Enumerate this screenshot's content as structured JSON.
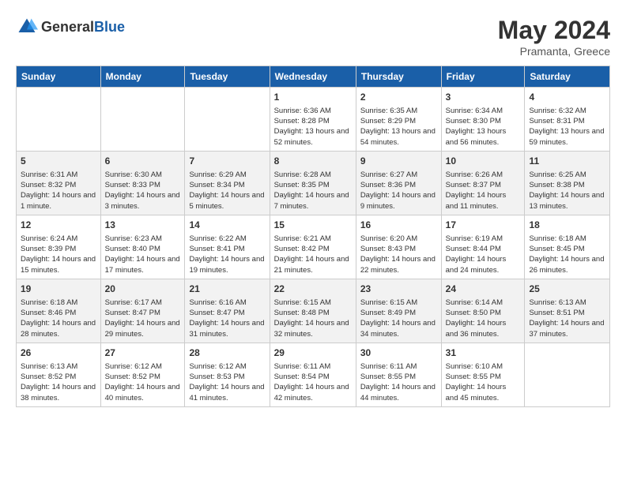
{
  "header": {
    "logo": {
      "general": "General",
      "blue": "Blue"
    },
    "title": "May 2024",
    "subtitle": "Pramanta, Greece"
  },
  "weekdays": [
    "Sunday",
    "Monday",
    "Tuesday",
    "Wednesday",
    "Thursday",
    "Friday",
    "Saturday"
  ],
  "weeks": [
    [
      null,
      null,
      null,
      {
        "day": "1",
        "sunrise": "Sunrise: 6:36 AM",
        "sunset": "Sunset: 8:28 PM",
        "daylight": "Daylight: 13 hours and 52 minutes."
      },
      {
        "day": "2",
        "sunrise": "Sunrise: 6:35 AM",
        "sunset": "Sunset: 8:29 PM",
        "daylight": "Daylight: 13 hours and 54 minutes."
      },
      {
        "day": "3",
        "sunrise": "Sunrise: 6:34 AM",
        "sunset": "Sunset: 8:30 PM",
        "daylight": "Daylight: 13 hours and 56 minutes."
      },
      {
        "day": "4",
        "sunrise": "Sunrise: 6:32 AM",
        "sunset": "Sunset: 8:31 PM",
        "daylight": "Daylight: 13 hours and 59 minutes."
      }
    ],
    [
      {
        "day": "5",
        "sunrise": "Sunrise: 6:31 AM",
        "sunset": "Sunset: 8:32 PM",
        "daylight": "Daylight: 14 hours and 1 minute."
      },
      {
        "day": "6",
        "sunrise": "Sunrise: 6:30 AM",
        "sunset": "Sunset: 8:33 PM",
        "daylight": "Daylight: 14 hours and 3 minutes."
      },
      {
        "day": "7",
        "sunrise": "Sunrise: 6:29 AM",
        "sunset": "Sunset: 8:34 PM",
        "daylight": "Daylight: 14 hours and 5 minutes."
      },
      {
        "day": "8",
        "sunrise": "Sunrise: 6:28 AM",
        "sunset": "Sunset: 8:35 PM",
        "daylight": "Daylight: 14 hours and 7 minutes."
      },
      {
        "day": "9",
        "sunrise": "Sunrise: 6:27 AM",
        "sunset": "Sunset: 8:36 PM",
        "daylight": "Daylight: 14 hours and 9 minutes."
      },
      {
        "day": "10",
        "sunrise": "Sunrise: 6:26 AM",
        "sunset": "Sunset: 8:37 PM",
        "daylight": "Daylight: 14 hours and 11 minutes."
      },
      {
        "day": "11",
        "sunrise": "Sunrise: 6:25 AM",
        "sunset": "Sunset: 8:38 PM",
        "daylight": "Daylight: 14 hours and 13 minutes."
      }
    ],
    [
      {
        "day": "12",
        "sunrise": "Sunrise: 6:24 AM",
        "sunset": "Sunset: 8:39 PM",
        "daylight": "Daylight: 14 hours and 15 minutes."
      },
      {
        "day": "13",
        "sunrise": "Sunrise: 6:23 AM",
        "sunset": "Sunset: 8:40 PM",
        "daylight": "Daylight: 14 hours and 17 minutes."
      },
      {
        "day": "14",
        "sunrise": "Sunrise: 6:22 AM",
        "sunset": "Sunset: 8:41 PM",
        "daylight": "Daylight: 14 hours and 19 minutes."
      },
      {
        "day": "15",
        "sunrise": "Sunrise: 6:21 AM",
        "sunset": "Sunset: 8:42 PM",
        "daylight": "Daylight: 14 hours and 21 minutes."
      },
      {
        "day": "16",
        "sunrise": "Sunrise: 6:20 AM",
        "sunset": "Sunset: 8:43 PM",
        "daylight": "Daylight: 14 hours and 22 minutes."
      },
      {
        "day": "17",
        "sunrise": "Sunrise: 6:19 AM",
        "sunset": "Sunset: 8:44 PM",
        "daylight": "Daylight: 14 hours and 24 minutes."
      },
      {
        "day": "18",
        "sunrise": "Sunrise: 6:18 AM",
        "sunset": "Sunset: 8:45 PM",
        "daylight": "Daylight: 14 hours and 26 minutes."
      }
    ],
    [
      {
        "day": "19",
        "sunrise": "Sunrise: 6:18 AM",
        "sunset": "Sunset: 8:46 PM",
        "daylight": "Daylight: 14 hours and 28 minutes."
      },
      {
        "day": "20",
        "sunrise": "Sunrise: 6:17 AM",
        "sunset": "Sunset: 8:47 PM",
        "daylight": "Daylight: 14 hours and 29 minutes."
      },
      {
        "day": "21",
        "sunrise": "Sunrise: 6:16 AM",
        "sunset": "Sunset: 8:47 PM",
        "daylight": "Daylight: 14 hours and 31 minutes."
      },
      {
        "day": "22",
        "sunrise": "Sunrise: 6:15 AM",
        "sunset": "Sunset: 8:48 PM",
        "daylight": "Daylight: 14 hours and 32 minutes."
      },
      {
        "day": "23",
        "sunrise": "Sunrise: 6:15 AM",
        "sunset": "Sunset: 8:49 PM",
        "daylight": "Daylight: 14 hours and 34 minutes."
      },
      {
        "day": "24",
        "sunrise": "Sunrise: 6:14 AM",
        "sunset": "Sunset: 8:50 PM",
        "daylight": "Daylight: 14 hours and 36 minutes."
      },
      {
        "day": "25",
        "sunrise": "Sunrise: 6:13 AM",
        "sunset": "Sunset: 8:51 PM",
        "daylight": "Daylight: 14 hours and 37 minutes."
      }
    ],
    [
      {
        "day": "26",
        "sunrise": "Sunrise: 6:13 AM",
        "sunset": "Sunset: 8:52 PM",
        "daylight": "Daylight: 14 hours and 38 minutes."
      },
      {
        "day": "27",
        "sunrise": "Sunrise: 6:12 AM",
        "sunset": "Sunset: 8:52 PM",
        "daylight": "Daylight: 14 hours and 40 minutes."
      },
      {
        "day": "28",
        "sunrise": "Sunrise: 6:12 AM",
        "sunset": "Sunset: 8:53 PM",
        "daylight": "Daylight: 14 hours and 41 minutes."
      },
      {
        "day": "29",
        "sunrise": "Sunrise: 6:11 AM",
        "sunset": "Sunset: 8:54 PM",
        "daylight": "Daylight: 14 hours and 42 minutes."
      },
      {
        "day": "30",
        "sunrise": "Sunrise: 6:11 AM",
        "sunset": "Sunset: 8:55 PM",
        "daylight": "Daylight: 14 hours and 44 minutes."
      },
      {
        "day": "31",
        "sunrise": "Sunrise: 6:10 AM",
        "sunset": "Sunset: 8:55 PM",
        "daylight": "Daylight: 14 hours and 45 minutes."
      },
      null
    ]
  ]
}
